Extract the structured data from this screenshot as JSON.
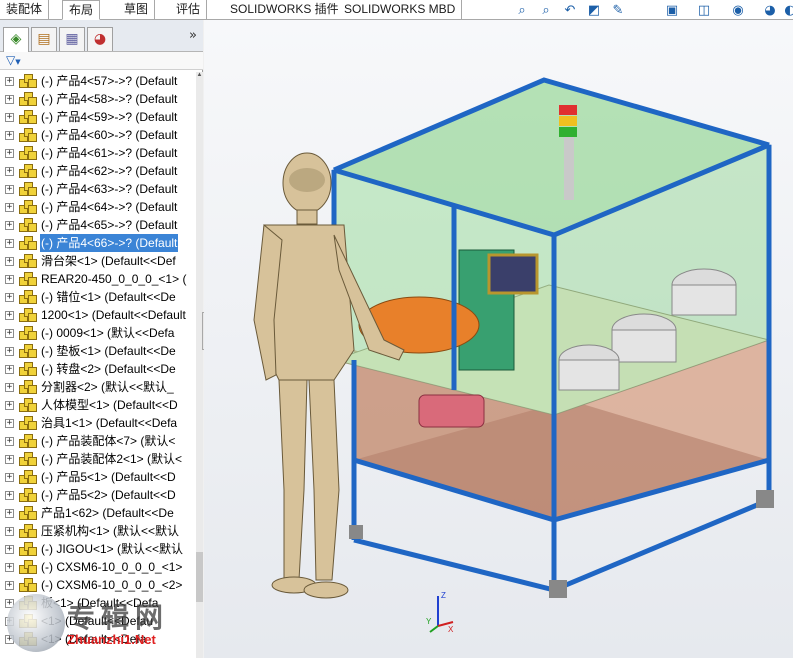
{
  "tabs": [
    {
      "label": "装配体",
      "active": false
    },
    {
      "label": "布局",
      "active": true
    },
    {
      "label": "草图",
      "active": false
    },
    {
      "label": "评估",
      "active": false
    },
    {
      "label": "SOLIDWORKS 插件",
      "active": false
    },
    {
      "label": "SOLIDWORKS MBD",
      "active": false
    }
  ],
  "view_toolbar": {
    "icons": [
      "zoom-to-fit-icon",
      "zoom-to-area-icon",
      "previous-view-icon",
      "section-view-icon",
      "dynamic-annotation-icon",
      "view-orientation-icon",
      "display-style-icon",
      "hide-show-items-icon",
      "appearance-icon",
      "scene-icon"
    ]
  },
  "panel": {
    "tab_icons": [
      "feature-manager-icon",
      "property-manager-icon",
      "configuration-manager-icon",
      "display-manager-icon"
    ],
    "collapse_glyph": "»",
    "filter_glyph": "▼"
  },
  "tree": {
    "selected_index": 9,
    "items": [
      "(-) 产品4<57>->? (Default",
      "(-) 产品4<58>->? (Default",
      "(-) 产品4<59>->? (Default",
      "(-) 产品4<60>->? (Default",
      "(-) 产品4<61>->? (Default",
      "(-) 产品4<62>->? (Default",
      "(-) 产品4<63>->? (Default",
      "(-) 产品4<64>->? (Default",
      "(-) 产品4<65>->? (Default",
      "(-) 产品4<66>->? (Default",
      "滑台架<1> (Default<<Def",
      "REAR20-450_0_0_0_<1> (",
      "(-) 错位<1> (Default<<De",
      "1200<1> (Default<<Default",
      "(-) 0009<1> (默认<<Defa",
      "(-) 垫板<1> (Default<<De",
      "(-) 转盘<2> (Default<<De",
      "分割器<2> (默认<<默认_",
      "人体模型<1> (Default<<D",
      "治具1<1> (Default<<Defa",
      "(-) 产品装配体<7> (默认<",
      "(-) 产品装配体2<1> (默认<",
      "(-) 产品5<1> (Default<<D",
      "(-) 产品5<2> (Default<<D",
      "产品1<62> (Default<<De",
      "压紧机构<1> (默认<<默认",
      "(-) JIGOU<1> (默认<<默认",
      "(-) CXSM6-10_0_0_0_<1> ",
      "(-) CXSM6-10_0_0_0_<2> ",
      "板<1> (Default<<Defa",
      "<1> (Default<<Defau",
      "<1> (Default<<Defa"
    ]
  },
  "triad": {
    "x_label": "X",
    "y_label": "Y",
    "z_label": "Z"
  },
  "watermark": {
    "title": "专辑网",
    "url": "Zhuanzhi1.Net"
  },
  "colors": {
    "frame_blue": "#1f66c4",
    "guard_green": "#7fd07f",
    "lower_panel": "#d49c80",
    "selection": "#3b84d6",
    "mannequin": "#d7c29a"
  }
}
